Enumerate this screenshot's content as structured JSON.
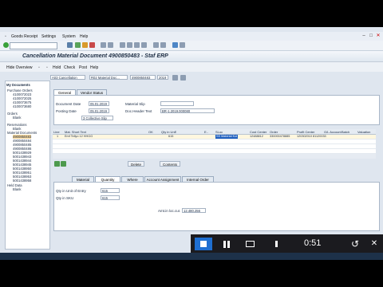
{
  "menu": [
    "Goods Receipt",
    "Settings",
    "System",
    "Help"
  ],
  "title": "Cancellation Material Document 4900850483 - Staf ERP",
  "app_toolbar": [
    "Hide Overview",
    "Hold",
    "Check",
    "Post",
    "Help"
  ],
  "sidebar": {
    "title": "My Documents",
    "purchase_orders": {
      "label": "Purchase Orders",
      "items": [
        "4100072023",
        "4100072025",
        "4100073675",
        "4100073680"
      ]
    },
    "orders": {
      "label": "Orders",
      "items": [
        "Blank"
      ]
    },
    "reservations": {
      "label": "Reservations",
      "items": [
        "Blank"
      ]
    },
    "material_documents": {
      "label": "Material Documents",
      "items": [
        "4900850483",
        "4900850484",
        "4900850485",
        "4900850486",
        "5001438929",
        "5001438943",
        "5001438944",
        "5001438945",
        "5001438950",
        "5001438951",
        "5001438953",
        "5001438958"
      ]
    },
    "held_data": {
      "label": "Held Data",
      "items": [
        "Blank"
      ]
    }
  },
  "header": {
    "action": "A03 Cancellation",
    "movement": "R02 Material Doc...",
    "doc_number": "4900850483",
    "year": "2019"
  },
  "tabs": {
    "header": [
      "General",
      "Vendor Status"
    ],
    "detail": [
      "Material",
      "Quantity",
      "Where",
      "Account Assignment",
      "Internal Order"
    ]
  },
  "general": {
    "document_date": {
      "label": "Document Date",
      "value": "05.01.2019"
    },
    "posting_date": {
      "label": "Posting Date",
      "value": "05.01.2019"
    },
    "slip": "3 Collective Slip",
    "material_slip": {
      "label": "Material Slip",
      "value": ""
    },
    "header_text": {
      "label": "Doc.Header Text",
      "value": "BR-1.2019.000080"
    }
  },
  "grid": {
    "columns": [
      "Line",
      "Mat. Short Text",
      "OK",
      "Qty in UnE",
      "E..",
      "SLoc",
      "Cost Center",
      "Order",
      "Profit Center",
      "G/L Account",
      "Batch",
      "Valuation"
    ],
    "rows": [
      {
        "line": "1",
        "text": "Emf Tellyo 12 HHGG",
        "qty": "615",
        "sloc": "SS Material Koi",
        "cost_center": "12488812",
        "order": "330000478885",
        "profit_center": "120302010 81120033"
      }
    ],
    "buttons": [
      "Delete",
      "Contents"
    ]
  },
  "quantity": {
    "unit_entry": {
      "label": "Qty in Unit of Entry",
      "value": "615"
    },
    "sku": {
      "label": "Qty in SKU",
      "value": "615"
    },
    "amount": {
      "label": "Amt.in loc.cur.",
      "value": "12.480.256"
    }
  },
  "video": {
    "time": "0:51"
  }
}
